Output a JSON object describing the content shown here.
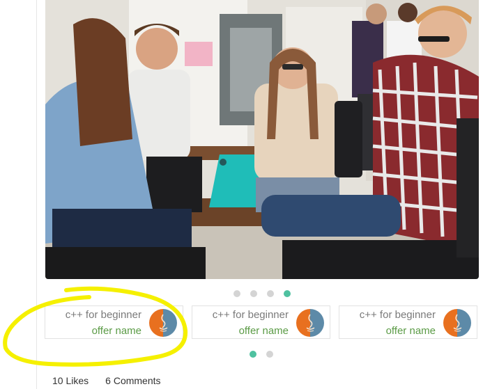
{
  "hero": {
    "image_icon": "group-photo-students-laptop"
  },
  "carousel_main": {
    "dots": [
      {
        "active": false
      },
      {
        "active": false
      },
      {
        "active": false
      },
      {
        "active": true
      }
    ]
  },
  "offers": [
    {
      "title": "c++ for beginner",
      "subtitle": "offer name",
      "logo_icon": "java-logo-icon"
    },
    {
      "title": "c++ for beginner",
      "subtitle": "offer name",
      "logo_icon": "java-logo-icon"
    },
    {
      "title": "c++ for beginner",
      "subtitle": "offer name",
      "logo_icon": "java-logo-icon"
    }
  ],
  "carousel_offers": {
    "dots": [
      {
        "active": true
      },
      {
        "active": false
      }
    ]
  },
  "stats": {
    "likes": "10 Likes",
    "comments": "6 Comments"
  },
  "colors": {
    "accent": "#4fc1a0",
    "subtitle": "#5b9b46",
    "highlight": "#f5f000",
    "logo_orange": "#e8701f",
    "logo_blue": "#5d8aa8"
  }
}
